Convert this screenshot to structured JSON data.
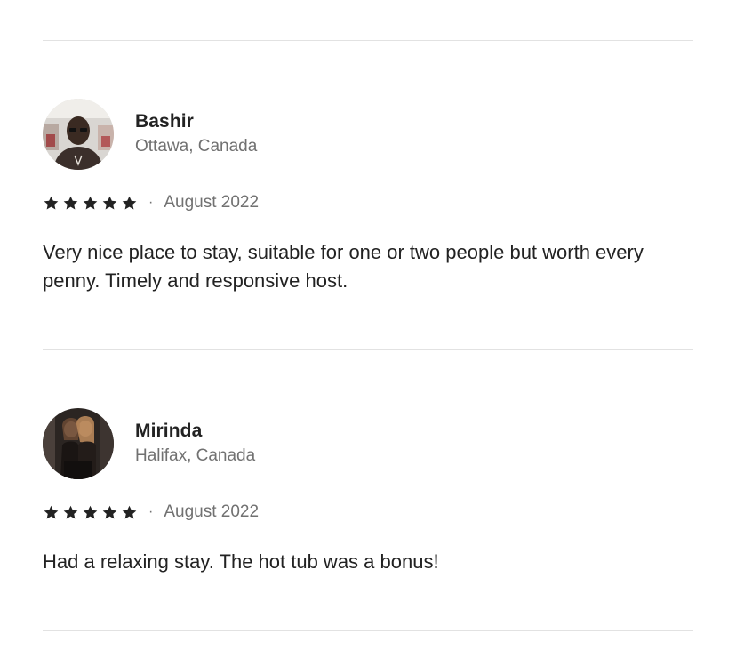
{
  "reviews": [
    {
      "name": "Bashir",
      "location": "Ottawa, Canada",
      "rating": 5,
      "separator": "·",
      "date": "August 2022",
      "text": "Very nice place to stay, suitable for one or two people but worth every penny. Timely and responsive host."
    },
    {
      "name": "Mirinda",
      "location": "Halifax, Canada",
      "rating": 5,
      "separator": "·",
      "date": "August 2022",
      "text": "Had a relaxing stay. The hot tub was a bonus!"
    }
  ],
  "icons": {
    "star": "star-icon",
    "avatar": "avatar"
  },
  "colors": {
    "text": "#222222",
    "muted": "#717171",
    "divider": "#e2e2e2",
    "star": "#222222"
  }
}
